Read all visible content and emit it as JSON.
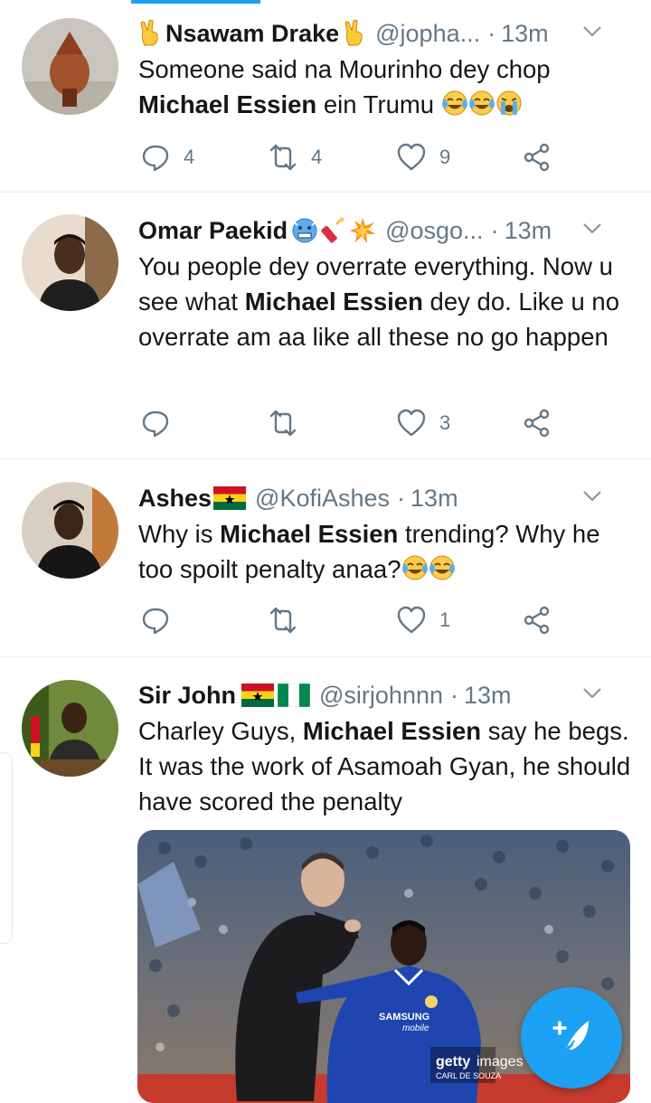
{
  "tweets": [
    {
      "name": "Nsawam Drake",
      "name_emojis": [
        "victory-hand",
        "victory-hand"
      ],
      "handle": "@jopha...",
      "time": "13m",
      "text_parts": [
        "Someone said na Mourinho dey chop ",
        "Michael Essien",
        " ein Trumu "
      ],
      "text_emojis": [
        "tears-of-joy",
        "tears-of-joy",
        "loudly-crying"
      ],
      "reply_count": "4",
      "retweet_count": "4",
      "like_count": "9"
    },
    {
      "name": "Omar Paekid",
      "name_emojis": [
        "cold-face",
        "firecracker",
        "collision"
      ],
      "handle": "@osgo...",
      "time": "13m",
      "text_parts": [
        "You people dey overrate everything. Now u see what ",
        "Michael Essien",
        " dey do. Like u no overrate am aa like all these no go happen"
      ],
      "reply_count": "",
      "retweet_count": "",
      "like_count": "3"
    },
    {
      "name": "Ashes",
      "name_emojis": [
        "ghana-flag"
      ],
      "handle": "@KofiAshes",
      "time": "13m",
      "text_parts": [
        "Why is ",
        "Michael Essien",
        " trending? Why he too spoilt penalty  anaa?"
      ],
      "text_emojis": [
        "tears-of-joy",
        "tears-of-joy"
      ],
      "reply_count": "",
      "retweet_count": "",
      "like_count": "1"
    },
    {
      "name": "Sir John",
      "name_emojis": [
        "ghana-flag",
        "nigeria-flag"
      ],
      "handle": "@sirjohnnn",
      "time": "13m",
      "text_parts": [
        "Charley Guys, ",
        "Michael Essien",
        " say he begs. It was the work of Asamoah Gyan, he should have scored the penalty"
      ],
      "media": {
        "watermark_brand": "getty",
        "watermark_word": "images",
        "watermark_credit": "CARL DE SOUZA",
        "shirt_sponsor_1": "SAMSUNG",
        "shirt_sponsor_2": "mobile"
      }
    }
  ],
  "dot_separator": "·",
  "icons": {
    "reply": "speech-bubble-icon",
    "retweet": "retweet-icon",
    "like": "heart-icon",
    "share": "share-icon",
    "more": "chevron-down-icon",
    "compose": "feather-plus-icon"
  },
  "colors": {
    "accent": "#1da1f2",
    "text": "#14171a",
    "secondary": "#657786",
    "divider": "#e6ecf0"
  }
}
